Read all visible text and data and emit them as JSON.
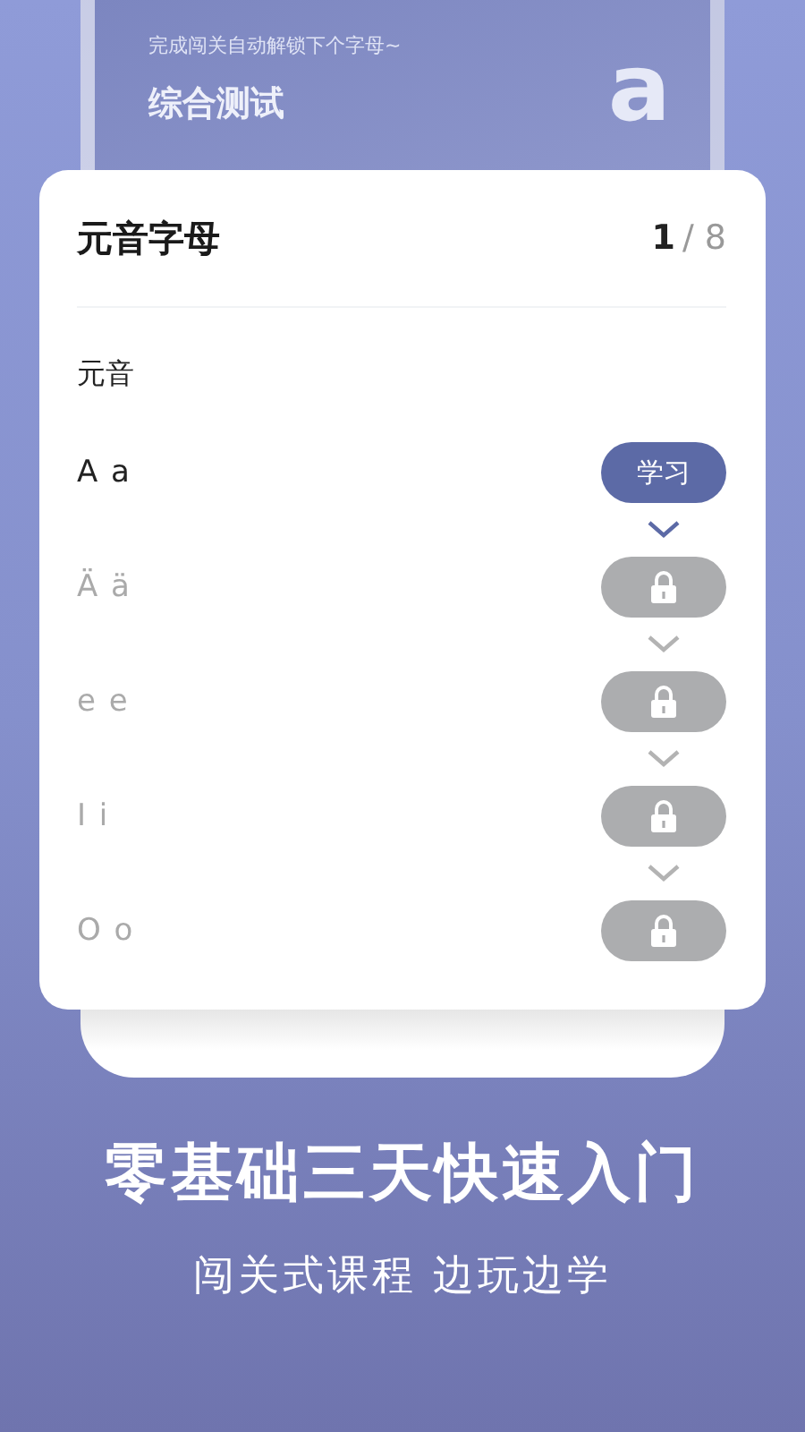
{
  "background_screen": {
    "hint": "完成闯关自动解锁下个字母~",
    "title": "综合测试",
    "letter": "a"
  },
  "card": {
    "title": "元音字母",
    "current": "1",
    "of_total": "/ 8",
    "section": "元音",
    "rows": [
      {
        "letters": "A a",
        "locked": false,
        "button": "学习"
      },
      {
        "letters": "Ä ä",
        "locked": true
      },
      {
        "letters": "e e",
        "locked": true
      },
      {
        "letters": "I i",
        "locked": true
      },
      {
        "letters": "O o",
        "locked": true
      }
    ]
  },
  "headline": "零基础三天快速入门",
  "subtitle": "闯关式课程 边玩边学"
}
